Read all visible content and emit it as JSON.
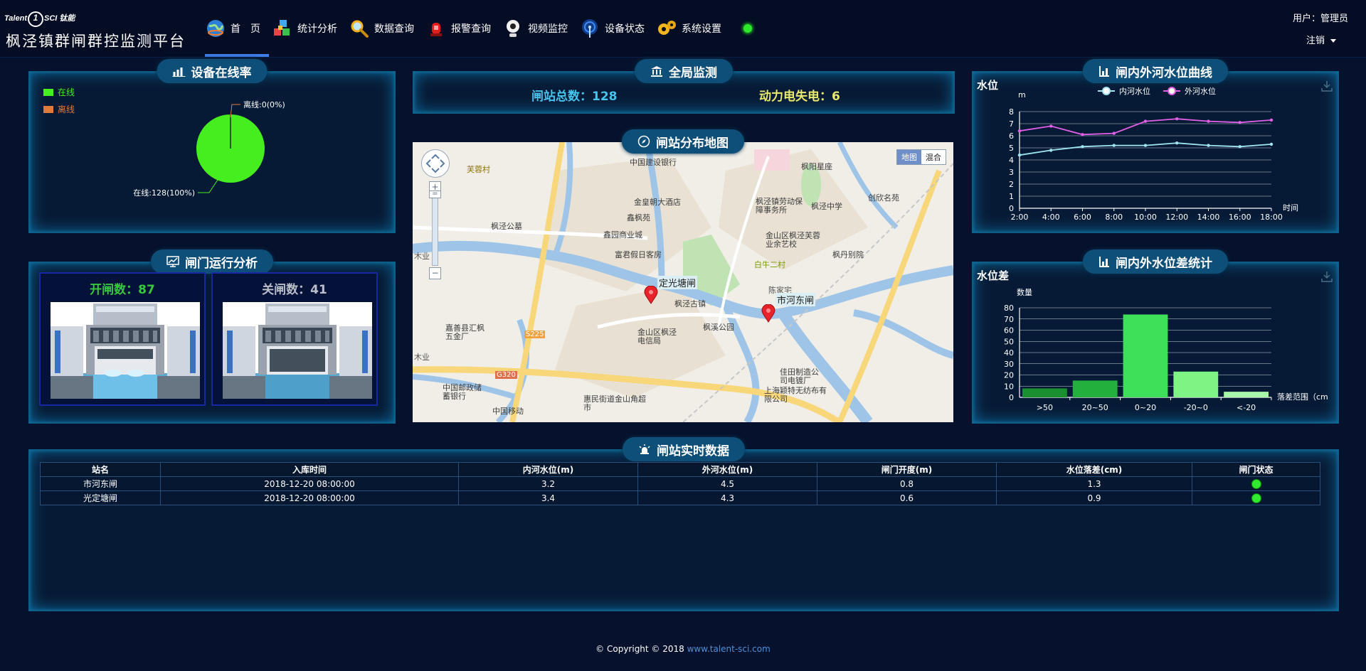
{
  "header": {
    "logo_prefix": "Talent",
    "logo_mark": "1",
    "logo_suffix": "SCI 钛能",
    "app_title": "枫泾镇群闸群控监测平台",
    "user_label": "用户：管理员",
    "logout_label": "注销"
  },
  "nav": [
    {
      "label": "首　页",
      "icon": "globe-icon",
      "active": true
    },
    {
      "label": "统计分析",
      "icon": "cubes-icon"
    },
    {
      "label": "数据查询",
      "icon": "magnifier-icon"
    },
    {
      "label": "报警查询",
      "icon": "alarm-light-icon"
    },
    {
      "label": "视频监控",
      "icon": "webcam-icon"
    },
    {
      "label": "设备状态",
      "icon": "antenna-icon"
    },
    {
      "label": "系统设置",
      "icon": "gears-icon"
    }
  ],
  "online": {
    "title": "设备在线率",
    "legend_online": "在线",
    "legend_offline": "离线",
    "label_offline": "离线:0(0%)",
    "label_online": "在线:128(100%)",
    "online_fraction": 1.0,
    "colors": {
      "online": "#45ef1f",
      "offline": "#e07a3a"
    }
  },
  "gates": {
    "title": "闸门运行分析",
    "open_label": "开闸数：87",
    "closed_label": "关闸数：41",
    "open_color": "#36c93a",
    "closed_color": "#b9bec8"
  },
  "global": {
    "title": "全局监测",
    "total_label": "闸站总数：128",
    "power_label": "动力电失电：6"
  },
  "map": {
    "title": "闸站分布地图",
    "type_map": "地图",
    "type_hybrid": "混合",
    "zoom_in": "+",
    "zoom_out": "−",
    "markers": [
      "定光塘闸",
      "市河东闸"
    ],
    "pois": [
      "中国建设银行",
      "枫阳星座",
      "芙蓉村",
      "金皇朝大酒店",
      "鑫枫苑",
      "枫泾镇劳动保障事务所",
      "枫泾中学",
      "创欣名苑",
      "枫泾公墓",
      "鑫园商业城",
      "富君假日客房",
      "金山区枫泾芙蓉业余艺校",
      "枫丹别院",
      "白牛二村",
      "枫泾古镇",
      "枫溪公园",
      "嘉善县汇枫五金厂",
      "金山区枫泾电信局",
      "S225",
      "G320",
      "中国邮政储蓄银行",
      "中国移动",
      "惠民街道金山角超市",
      "佳田制造公司电镀厂",
      "上海颖特无纺布有限公司",
      "陈家宅",
      "木业",
      "木业"
    ]
  },
  "water_line": {
    "title": "闸内外河水位曲线",
    "chart_data": {
      "type": "line",
      "title": "水位",
      "ylabel": "m",
      "xlabel": "时间",
      "categories": [
        "2:00",
        "4:00",
        "6:00",
        "8:00",
        "10:00",
        "12:00",
        "14:00",
        "16:00",
        "18:00"
      ],
      "ylim": [
        0,
        8
      ],
      "yticks": [
        0,
        1,
        2,
        3,
        4,
        5,
        6,
        7,
        8
      ],
      "legend_position": "top",
      "grid": true,
      "series": [
        {
          "name": "内河水位",
          "color": "#9fe6f0",
          "values": [
            4.4,
            4.8,
            5.1,
            5.2,
            5.2,
            5.4,
            5.2,
            5.1,
            5.3
          ]
        },
        {
          "name": "外河水位",
          "color": "#e15fe6",
          "values": [
            6.4,
            6.8,
            6.1,
            6.2,
            7.2,
            7.4,
            7.2,
            7.1,
            7.3
          ]
        }
      ]
    }
  },
  "water_diff": {
    "title": "闸内外水位差统计",
    "chart_data": {
      "type": "bar",
      "title": "水位差",
      "ylabel": "数量",
      "xlabel": "落差范围（cm",
      "categories": [
        ">50",
        "20~50",
        "0~20",
        "-20~0",
        "<-20"
      ],
      "values": [
        8,
        15,
        74,
        23,
        5
      ],
      "ylim": [
        0,
        80
      ],
      "yticks": [
        0,
        10,
        20,
        30,
        40,
        50,
        60,
        70,
        80
      ],
      "colors": [
        "#1a8f30",
        "#23b03c",
        "#3ee05a",
        "#7df483",
        "#a8f8ac"
      ],
      "grid": true
    }
  },
  "realtime": {
    "title": "闸站实时数据",
    "columns": [
      "站名",
      "入库时间",
      "内河水位(m)",
      "外河水位(m)",
      "闸门开度(m)",
      "水位落差(cm)",
      "闸门状态"
    ],
    "rows": [
      [
        "市河东闸",
        "2018-12-20 08:00:00",
        "3.2",
        "4.5",
        "0.8",
        "1.3"
      ],
      [
        "光定塘闸",
        "2018-12-20 08:00:00",
        "3.4",
        "4.3",
        "0.6",
        "0.9"
      ]
    ]
  },
  "footer": {
    "copyright": "© Copyright © 2018 ",
    "site": "www.talent-sci.com"
  }
}
